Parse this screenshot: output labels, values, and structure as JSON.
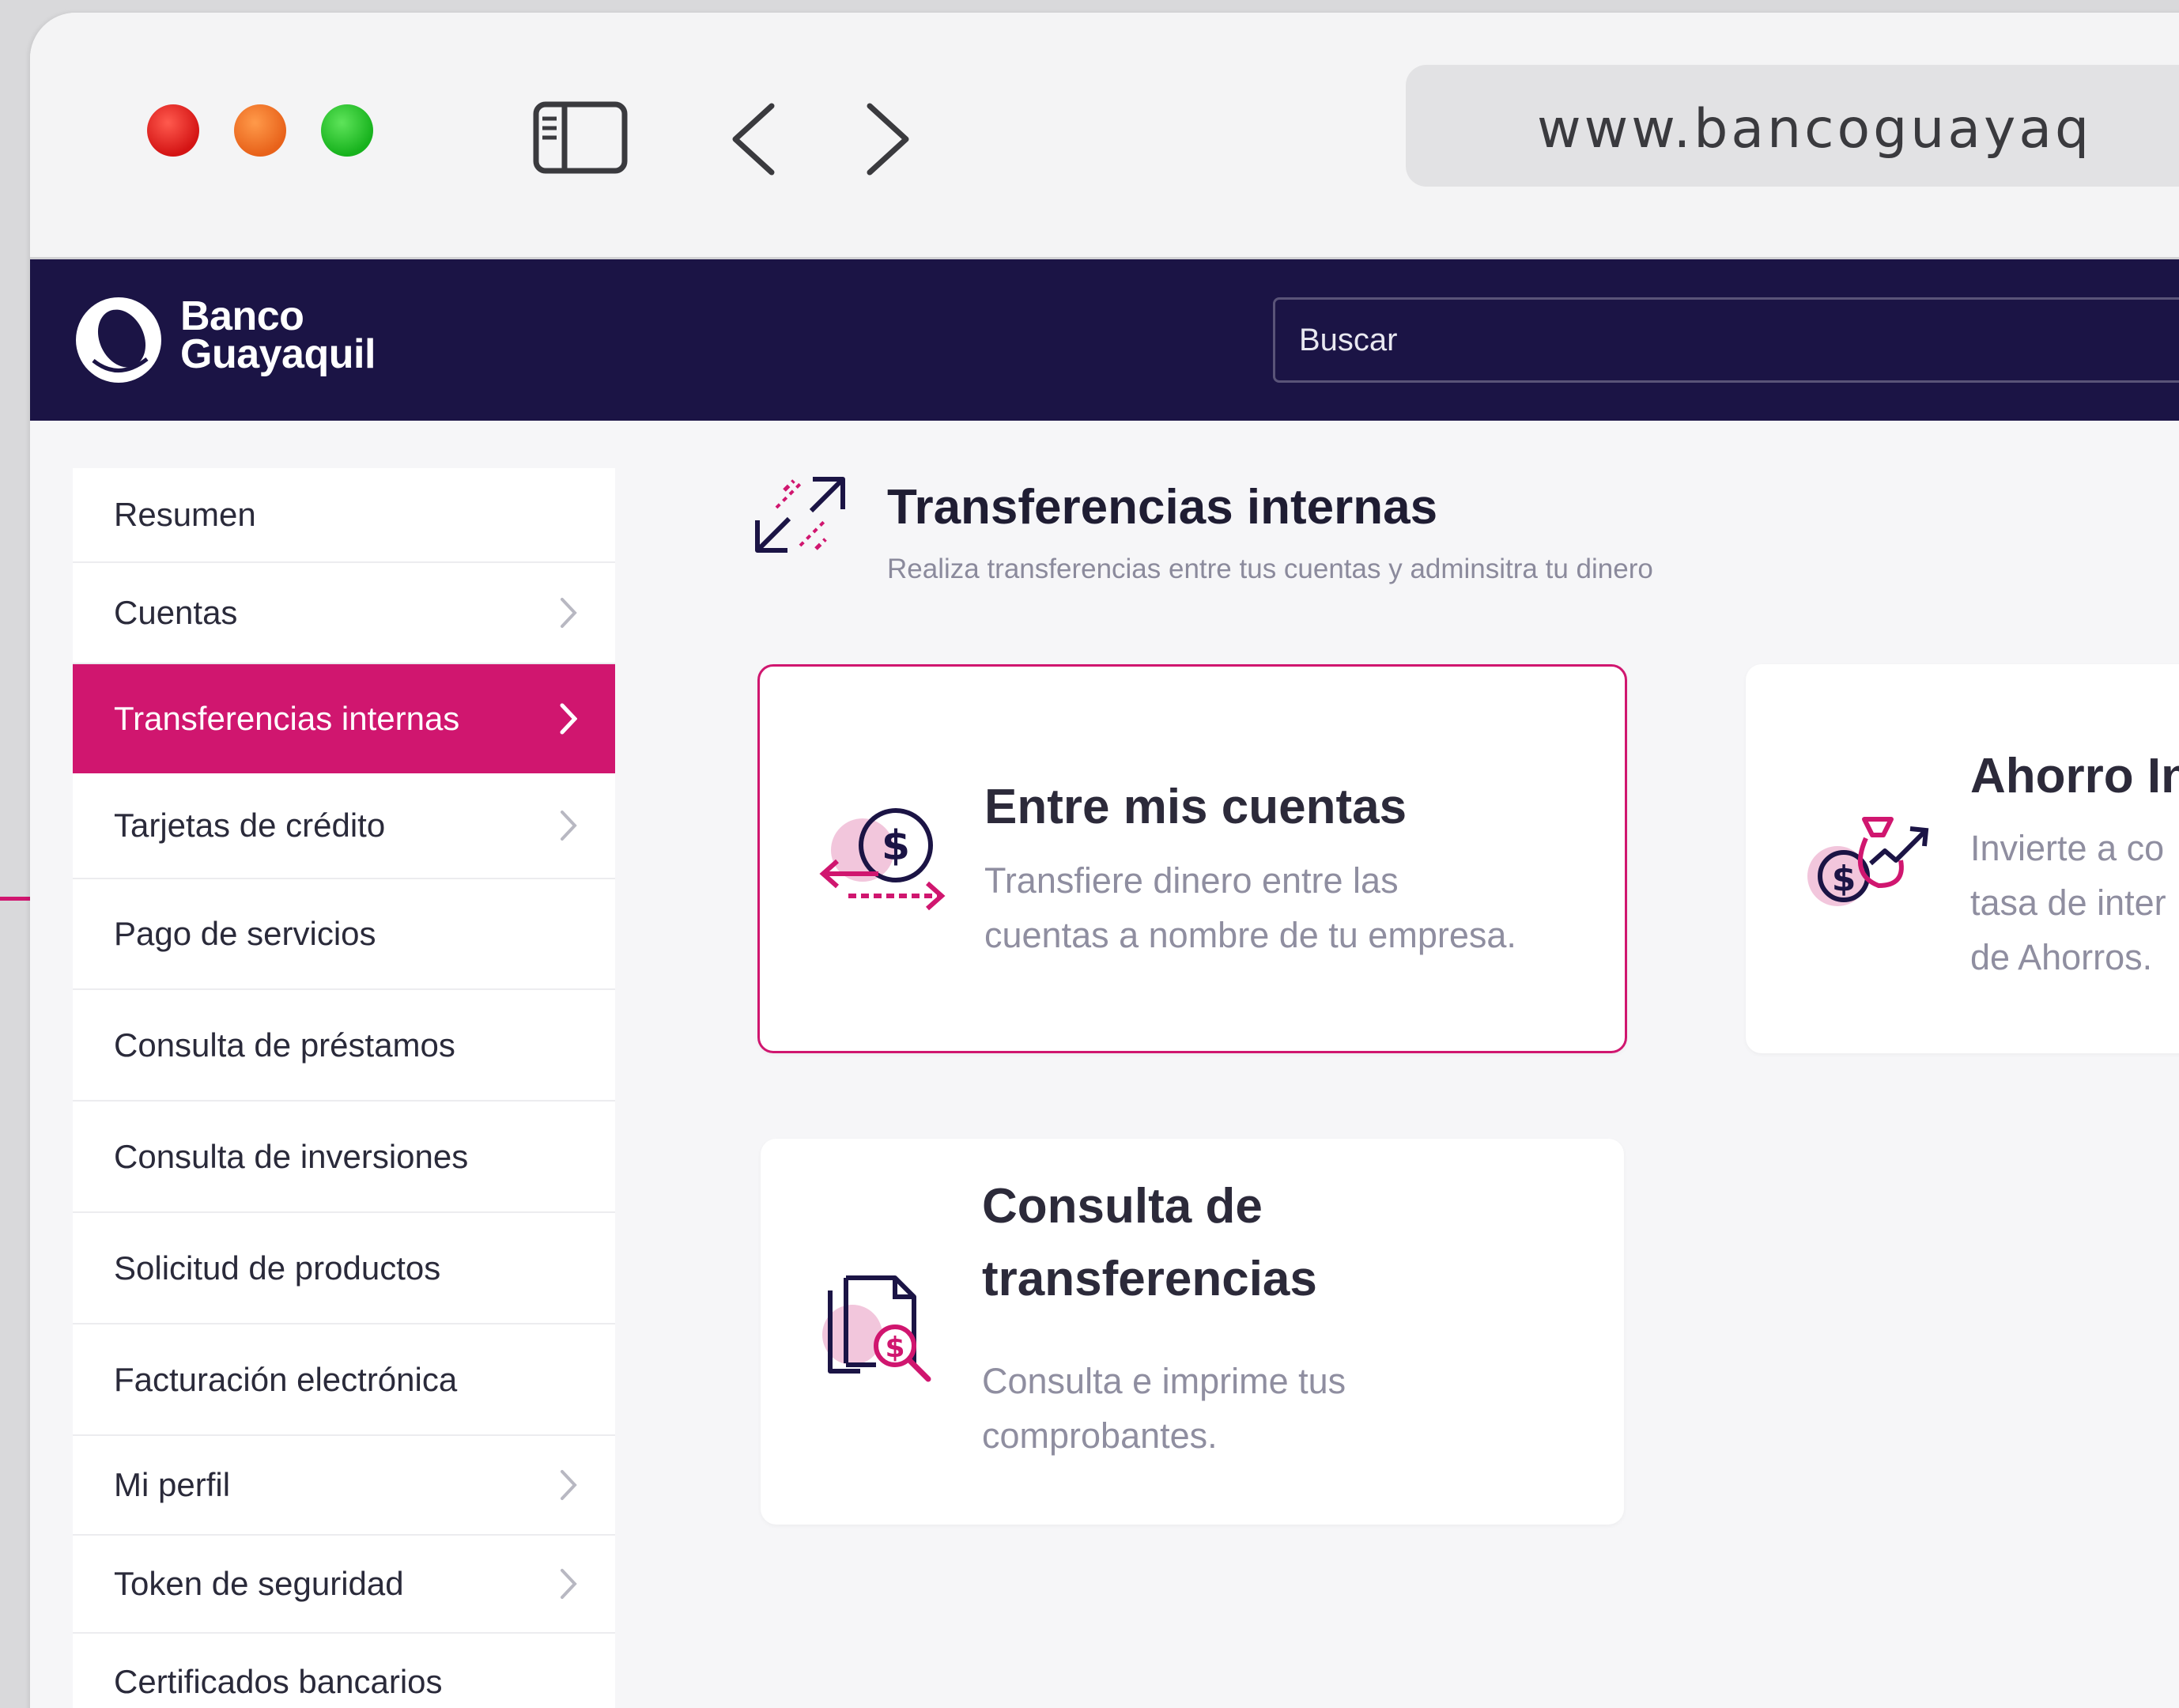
{
  "browser": {
    "url": "www.bancoguayaq"
  },
  "header": {
    "logo_line1": "Banco",
    "logo_line2": "Guayaquil",
    "search_placeholder": "Buscar"
  },
  "sidebar": {
    "items": [
      {
        "label": "Resumen",
        "chevron": false,
        "active": false
      },
      {
        "label": "Cuentas",
        "chevron": true,
        "active": false
      },
      {
        "label": "Transferencias internas",
        "chevron": true,
        "active": true
      },
      {
        "label": "Tarjetas de crédito",
        "chevron": true,
        "active": false
      },
      {
        "label": "Pago de servicios",
        "chevron": false,
        "active": false
      },
      {
        "label": "Consulta de préstamos",
        "chevron": false,
        "active": false
      },
      {
        "label": "Consulta de inversiones",
        "chevron": false,
        "active": false
      },
      {
        "label": "Solicitud de productos",
        "chevron": false,
        "active": false
      },
      {
        "label": "Facturación electrónica",
        "chevron": false,
        "active": false
      },
      {
        "label": "Mi perfil",
        "chevron": true,
        "active": false
      },
      {
        "label": "Token de seguridad",
        "chevron": true,
        "active": false
      },
      {
        "label": "Certificados bancarios",
        "chevron": false,
        "active": false
      }
    ]
  },
  "main": {
    "title": "Transferencias internas",
    "subtitle": "Realiza transferencias entre tus cuentas y adminsitra tu dinero",
    "cards": [
      {
        "title": "Entre mis cuentas",
        "desc_line1": "Transfiere dinero entre las",
        "desc_line2": "cuentas a nombre de tu empresa.",
        "icon": "transfer-coin-icon"
      },
      {
        "title": "Ahorro In",
        "desc_line1": "Invierte a co",
        "desc_line2": "tasa de inter",
        "desc_line3": "de Ahorros.",
        "icon": "savings-bag-icon"
      },
      {
        "title_line1": "Consulta de",
        "title_line2": "transferencias",
        "desc_line1": "Consulta e imprime tus",
        "desc_line2": "comprobantes.",
        "icon": "document-search-icon"
      }
    ]
  },
  "colors": {
    "brand_navy": "#1b1445",
    "accent_magenta": "#d0166f",
    "accent_pink_light": "#f2c6dc"
  }
}
